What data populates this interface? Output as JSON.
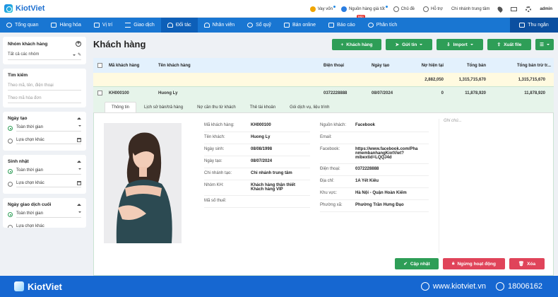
{
  "app": {
    "brand": "KiotViet"
  },
  "topbar": {
    "loan": "Vay vốn",
    "supply": "Nguồn hàng giá tốt",
    "supply_badge": "Mới",
    "theme": "Chủ đề",
    "support": "Hỗ trợ",
    "branch": "Chi nhánh trung tâm",
    "user": "admin"
  },
  "nav": {
    "items": [
      "Tổng quan",
      "Hàng hóa",
      "Vị trí",
      "Giao dịch",
      "Đối tác",
      "Nhân viên",
      "Sổ quỹ",
      "Bán online",
      "Báo cáo",
      "Phân tích"
    ],
    "cashier": "Thu ngân"
  },
  "sidebar": {
    "group_title": "Nhóm khách hàng",
    "group_value": "Tất cả các nhóm",
    "search_title": "Tìm kiếm",
    "search_ph1": "Theo mã, tên, điện thoại",
    "search_ph2": "Theo mã hóa đơn",
    "created_title": "Ngày tạo",
    "birthday_title": "Sinh nhật",
    "lasttx_title": "Ngày giao dịch cuối",
    "all_time": "Toàn thời gian",
    "other": "Lựa chọn khác"
  },
  "page": {
    "title": "Khách hàng"
  },
  "actions": {
    "add": "Khách hàng",
    "send": "Gửi tin",
    "import": "Import",
    "export": "Xuất file"
  },
  "table": {
    "headers": [
      "Mã khách hàng",
      "Tên khách hàng",
      "Điện thoại",
      "Ngày tạo",
      "Nợ hiện tại",
      "Tổng bán",
      "Tổng bán trừ tr..."
    ],
    "summary": {
      "debt": "2,882,050",
      "total": "1,315,715,670",
      "net": "1,315,715,670"
    },
    "row": {
      "code": "KH000100",
      "name": "Huong Ly",
      "phone": "0372228888",
      "date": "08/07/2024",
      "debt": "0",
      "total": "11,878,920",
      "net": "11,878,920"
    }
  },
  "tabs": [
    "Thông tin",
    "Lịch sử bán/trả hàng",
    "Nợ cần thu từ khách",
    "Thẻ tài khoản",
    "Gói dịch vụ, liệu trình"
  ],
  "detail": {
    "left": [
      {
        "k": "Mã khách hàng:",
        "v": "KH000100"
      },
      {
        "k": "Tên khách:",
        "v": "Huong Ly"
      },
      {
        "k": "Ngày sinh:",
        "v": "08/08/1998"
      },
      {
        "k": "Ngày tạo:",
        "v": "08/07/2024"
      },
      {
        "k": "Chi nhánh tạo:",
        "v": "Chi nhánh trung tâm"
      },
      {
        "k": "Nhóm KH:",
        "v": "Khách hàng thân thiết\nKhách hàng VIP"
      },
      {
        "k": "Mã số thuế:",
        "v": ""
      }
    ],
    "right": [
      {
        "k": "Nguồn khách:",
        "v": "Facebook"
      },
      {
        "k": "Email:",
        "v": ""
      },
      {
        "k": "Facebook:",
        "v": "https://www.facebook.com/Pha\nnmembanhangKiotViet?\nmibextid=LQQJ4d"
      },
      {
        "k": "Điện thoại:",
        "v": "0372228888"
      },
      {
        "k": "Địa chỉ:",
        "v": "1A Yết Kiêu"
      },
      {
        "k": "Khu vực:",
        "v": "Hà Nội - Quận Hoàn Kiếm"
      },
      {
        "k": "Phường xã:",
        "v": "Phường Trần Hưng Đạo"
      }
    ],
    "notes_ph": "Ghi chú...",
    "btn_update": "Cập nhật",
    "btn_stop": "Ngừng hoạt động",
    "btn_delete": "Xóa"
  },
  "footer": {
    "brand": "KiotViet",
    "site": "www.kiotviet.vn",
    "phone": "18006162"
  }
}
